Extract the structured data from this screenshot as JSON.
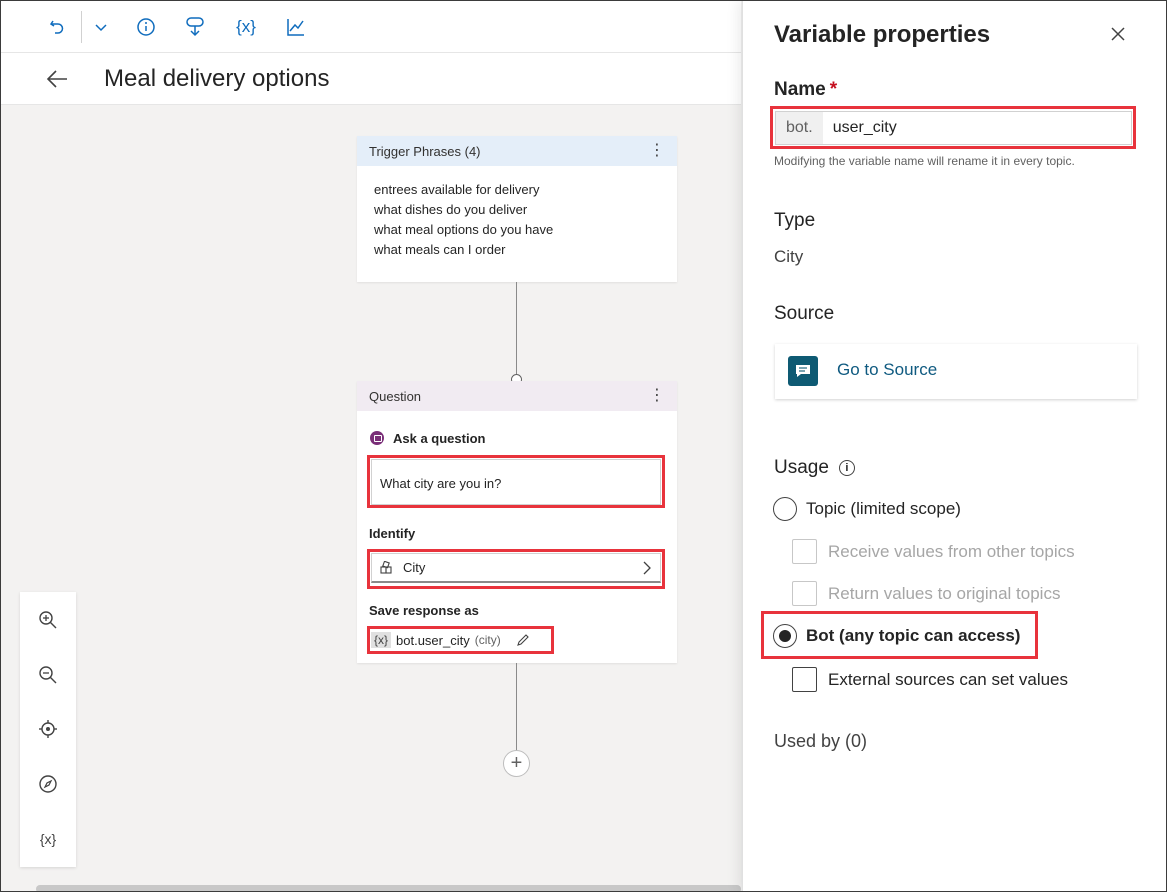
{
  "header": {
    "title": "Meal delivery options"
  },
  "trigger_card": {
    "title": "Trigger Phrases (4)",
    "phrases": [
      "entrees available for delivery",
      "what dishes do you deliver",
      "what meal options do you have",
      "what meals can I order"
    ]
  },
  "question_card": {
    "title": "Question",
    "ask_label": "Ask a question",
    "question_text": "What city are you in?",
    "identify_label": "Identify",
    "identify_value": "City",
    "save_label": "Save response as",
    "var_chip": "{x}",
    "var_name": "bot.user_city",
    "var_type": "(city)"
  },
  "zoom_panel": {
    "variables_label": "{x}"
  },
  "panel": {
    "title": "Variable properties",
    "name_label": "Name",
    "required_mark": "*",
    "name_prefix": "bot.",
    "name_value": "user_city",
    "name_helper": "Modifying the variable name will rename it in every topic.",
    "type_label": "Type",
    "type_value": "City",
    "source_label": "Source",
    "source_link": "Go to Source",
    "usage_label": "Usage",
    "usage_options": {
      "topic": "Topic (limited scope)",
      "receive": "Receive values from other topics",
      "return": "Return values to original topics",
      "bot": "Bot (any topic can access)",
      "external": "External sources can set values"
    },
    "used_by": "Used by (0)"
  },
  "colors": {
    "accent": "#0f6cbd",
    "highlight": "#e8333c",
    "source_icon_bg": "#0e5a73"
  }
}
